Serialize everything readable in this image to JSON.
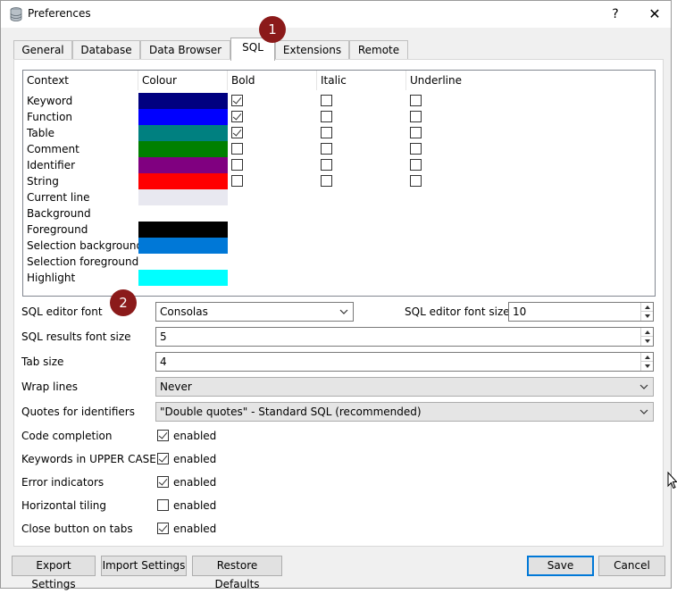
{
  "window": {
    "title": "Preferences",
    "help": "?",
    "close": "✕"
  },
  "tabs": [
    "General",
    "Database",
    "Data Browser",
    "SQL",
    "Extensions",
    "Remote"
  ],
  "active_tab": "SQL",
  "badges": [
    "1",
    "2"
  ],
  "colors_table": {
    "headers": [
      "Context",
      "Colour",
      "Bold",
      "Italic",
      "Underline"
    ],
    "rows": [
      {
        "context": "Keyword",
        "colour": "#000080",
        "bold": true,
        "italic": false,
        "underline": false
      },
      {
        "context": "Function",
        "colour": "#0000ff",
        "bold": true,
        "italic": false,
        "underline": false
      },
      {
        "context": "Table",
        "colour": "#008080",
        "bold": true,
        "italic": false,
        "underline": false
      },
      {
        "context": "Comment",
        "colour": "#008000",
        "bold": false,
        "italic": false,
        "underline": false
      },
      {
        "context": "Identifier",
        "colour": "#800080",
        "bold": false,
        "italic": false,
        "underline": false
      },
      {
        "context": "String",
        "colour": "#ff0000",
        "bold": false,
        "italic": false,
        "underline": false
      },
      {
        "context": "Current line",
        "colour": "#e8e8f0"
      },
      {
        "context": "Background",
        "colour": "#ffffff"
      },
      {
        "context": "Foreground",
        "colour": "#000000"
      },
      {
        "context": "Selection background",
        "colour": "#0078d7"
      },
      {
        "context": "Selection foreground",
        "colour": "#ffffff"
      },
      {
        "context": "Highlight",
        "colour": "#00ffff"
      }
    ]
  },
  "settings": {
    "editor_font_label": "SQL editor font",
    "editor_font_value": "Consolas",
    "editor_font_size_label": "SQL editor font size",
    "editor_font_size_value": "10",
    "results_font_size_label": "SQL results font size",
    "results_font_size_value": "5",
    "tab_size_label": "Tab size",
    "tab_size_value": "4",
    "wrap_lines_label": "Wrap lines",
    "wrap_lines_value": "Never",
    "quotes_label": "Quotes for identifiers",
    "quotes_value": "\"Double quotes\" - Standard SQL (recommended)",
    "toggles": [
      {
        "label": "Code completion",
        "checked": true,
        "text": "enabled"
      },
      {
        "label": "Keywords in UPPER CASE",
        "checked": true,
        "text": "enabled"
      },
      {
        "label": "Error indicators",
        "checked": true,
        "text": "enabled"
      },
      {
        "label": "Horizontal tiling",
        "checked": false,
        "text": "enabled"
      },
      {
        "label": "Close button on tabs",
        "checked": true,
        "text": "enabled"
      }
    ]
  },
  "buttons": {
    "export": "Export Settings",
    "import": "Import Settings",
    "restore": "Restore Defaults",
    "save": "Save",
    "cancel": "Cancel"
  }
}
